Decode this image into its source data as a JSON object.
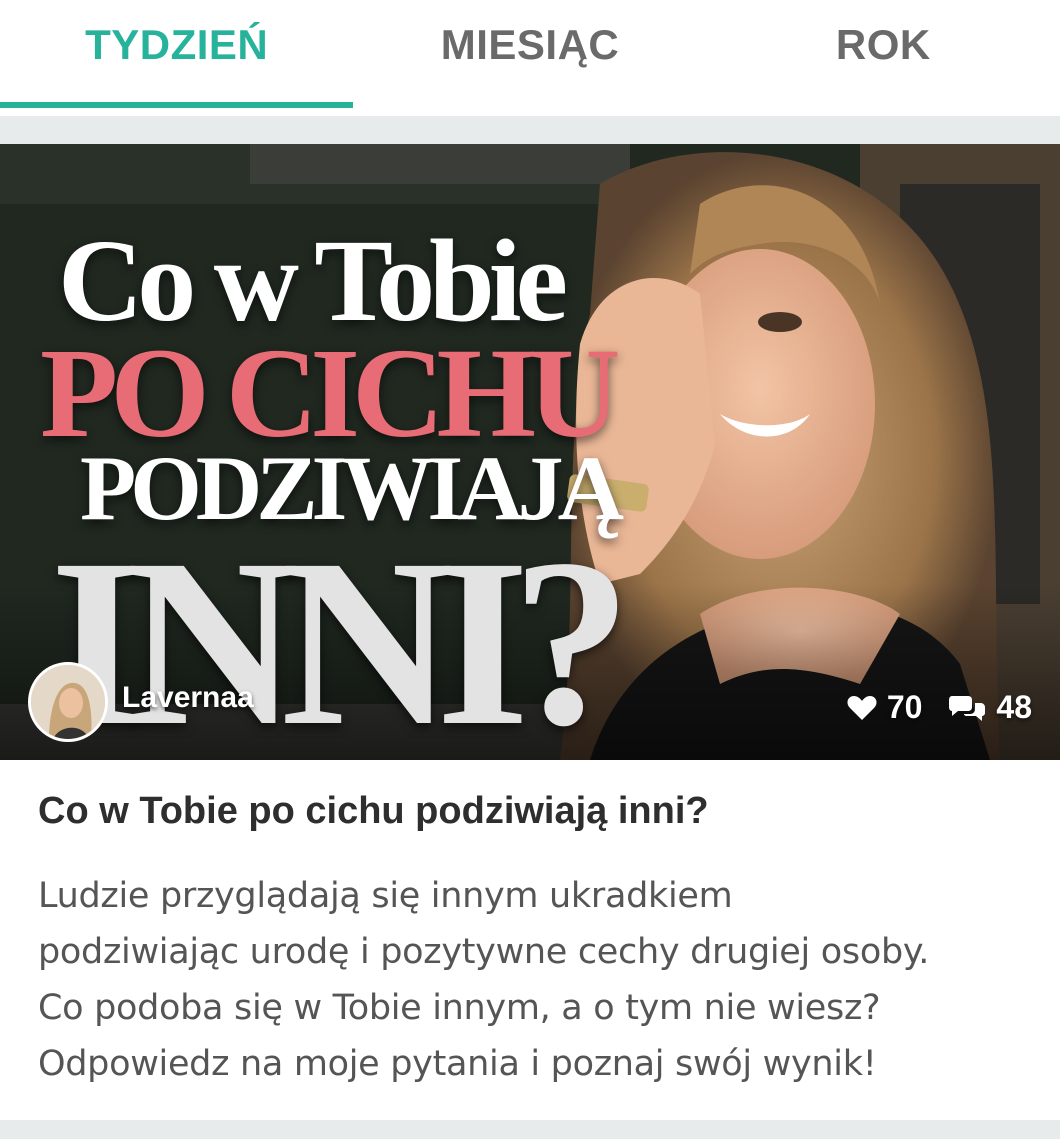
{
  "tabs": [
    {
      "label": "TYDZIEŃ",
      "active": true
    },
    {
      "label": "MIESIĄC",
      "active": false
    },
    {
      "label": "ROK",
      "active": false
    }
  ],
  "card": {
    "image": {
      "headline": [
        "Co w Tobie",
        "PO CICHU",
        "PODZIWIAJĄ",
        "INNI?"
      ]
    },
    "author": {
      "name": "Lavernaa",
      "avatar_icon": "avatar-photo"
    },
    "stats": {
      "likes": "70",
      "comments": "48",
      "like_icon": "heart-icon",
      "comment_icon": "comments-icon"
    },
    "title": "Co w Tobie po cichu podziwiają inni?",
    "description_lines": [
      "Ludzie przyglądają się innym ukradkiem",
      "podziwiając urodę i pozytywne cechy drugiej osoby.",
      "Co podoba się w Tobie innym, a o tym nie wiesz?",
      "Odpowiedz na moje pytania i poznaj swój wynik!"
    ]
  },
  "colors": {
    "accent": "#27b39b",
    "headline_pink": "#e86c76"
  }
}
